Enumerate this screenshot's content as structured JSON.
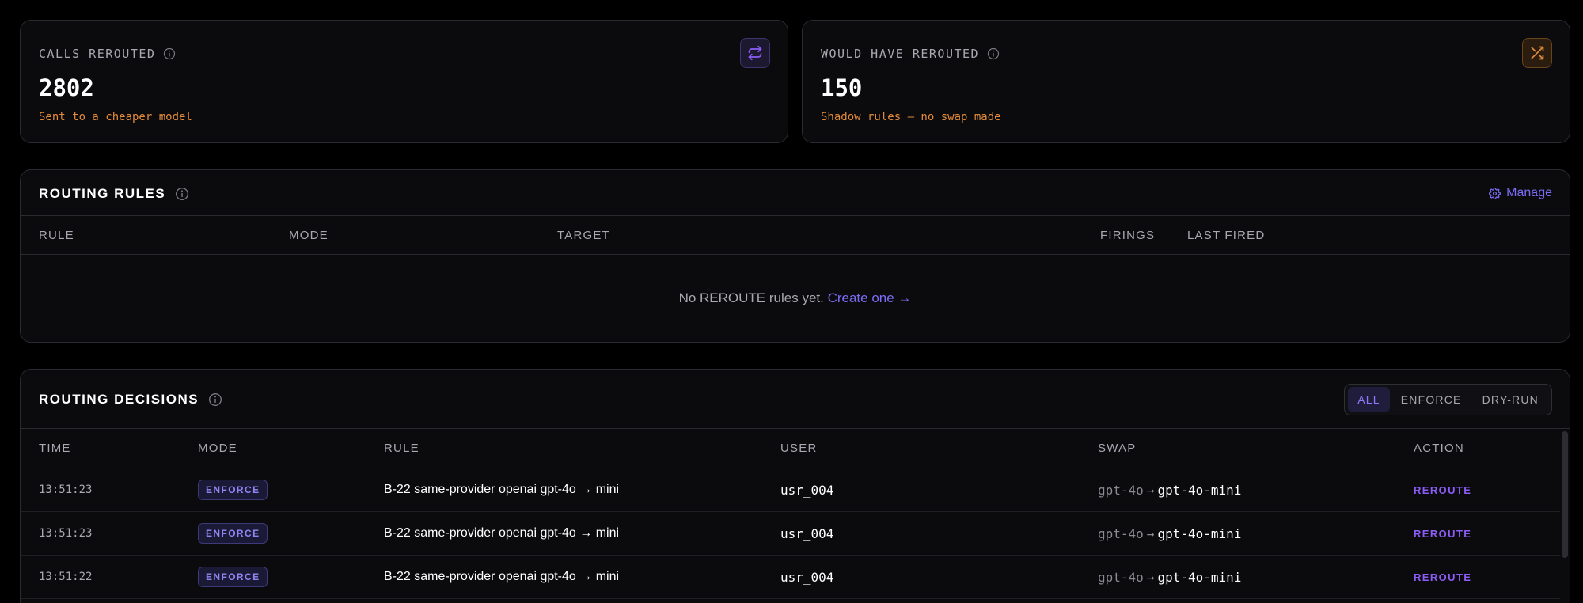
{
  "stats": [
    {
      "label": "CALLS REROUTED",
      "value": "2802",
      "sub": "Sent to a cheaper model",
      "icon": "repeat-icon",
      "accent": "#8b5cf6"
    },
    {
      "label": "WOULD HAVE REROUTED",
      "value": "150",
      "sub": "Shadow rules — no swap made",
      "icon": "shuffle-icon",
      "accent": "#e38b3a"
    }
  ],
  "rules": {
    "title": "ROUTING RULES",
    "manage_label": "Manage",
    "columns": [
      "RULE",
      "MODE",
      "TARGET",
      "FIRINGS",
      "LAST FIRED"
    ],
    "empty_text": "No REROUTE rules yet.",
    "empty_link": "Create one →"
  },
  "decisions": {
    "title": "ROUTING DECISIONS",
    "filters": [
      "ALL",
      "ENFORCE",
      "DRY-RUN"
    ],
    "active_filter": "ALL",
    "columns": [
      "TIME",
      "MODE",
      "RULE",
      "USER",
      "SWAP",
      "ACTION"
    ],
    "rows": [
      {
        "time": "13:51:23",
        "mode": "ENFORCE",
        "rule": "B-22 same-provider openai gpt-4o → mini",
        "user": "usr_004",
        "swap_from": "gpt-4o",
        "swap_arrow": "→",
        "swap_to": "gpt-4o-mini",
        "action": "REROUTE"
      },
      {
        "time": "13:51:23",
        "mode": "ENFORCE",
        "rule": "B-22 same-provider openai gpt-4o → mini",
        "user": "usr_004",
        "swap_from": "gpt-4o",
        "swap_arrow": "→",
        "swap_to": "gpt-4o-mini",
        "action": "REROUTE"
      },
      {
        "time": "13:51:22",
        "mode": "ENFORCE",
        "rule": "B-22 same-provider openai gpt-4o → mini",
        "user": "usr_004",
        "swap_from": "gpt-4o",
        "swap_arrow": "→",
        "swap_to": "gpt-4o-mini",
        "action": "REROUTE"
      }
    ]
  },
  "colors": {
    "background": "#000000",
    "card": "#0b0b0d",
    "border": "#2a2a30",
    "accent_purple": "#7b6cf6",
    "accent_orange": "#e38b3a"
  }
}
